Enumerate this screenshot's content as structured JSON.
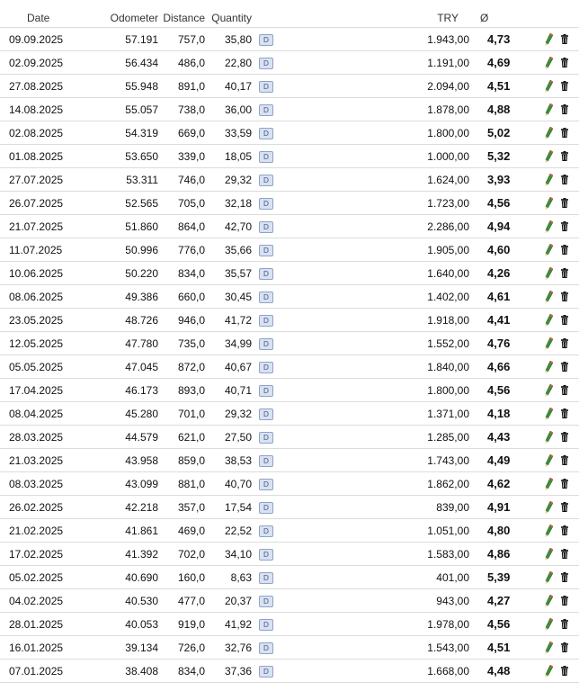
{
  "table": {
    "headers": {
      "date": "Date",
      "odometer": "Odometer",
      "distance": "Distance",
      "quantity": "Quantity",
      "cost": "TRY",
      "average": "Ø"
    },
    "rows": [
      {
        "date": "09.09.2025",
        "odometer": "57.191",
        "distance": "757,0",
        "quantity": "35,80",
        "badge": "D",
        "cost": "1.943,00",
        "average": "4,73"
      },
      {
        "date": "02.09.2025",
        "odometer": "56.434",
        "distance": "486,0",
        "quantity": "22,80",
        "badge": "D",
        "cost": "1.191,00",
        "average": "4,69"
      },
      {
        "date": "27.08.2025",
        "odometer": "55.948",
        "distance": "891,0",
        "quantity": "40,17",
        "badge": "D",
        "cost": "2.094,00",
        "average": "4,51"
      },
      {
        "date": "14.08.2025",
        "odometer": "55.057",
        "distance": "738,0",
        "quantity": "36,00",
        "badge": "D",
        "cost": "1.878,00",
        "average": "4,88"
      },
      {
        "date": "02.08.2025",
        "odometer": "54.319",
        "distance": "669,0",
        "quantity": "33,59",
        "badge": "D",
        "cost": "1.800,00",
        "average": "5,02"
      },
      {
        "date": "01.08.2025",
        "odometer": "53.650",
        "distance": "339,0",
        "quantity": "18,05",
        "badge": "D",
        "cost": "1.000,00",
        "average": "5,32"
      },
      {
        "date": "27.07.2025",
        "odometer": "53.311",
        "distance": "746,0",
        "quantity": "29,32",
        "badge": "D",
        "cost": "1.624,00",
        "average": "3,93"
      },
      {
        "date": "26.07.2025",
        "odometer": "52.565",
        "distance": "705,0",
        "quantity": "32,18",
        "badge": "D",
        "cost": "1.723,00",
        "average": "4,56"
      },
      {
        "date": "21.07.2025",
        "odometer": "51.860",
        "distance": "864,0",
        "quantity": "42,70",
        "badge": "D",
        "cost": "2.286,00",
        "average": "4,94"
      },
      {
        "date": "11.07.2025",
        "odometer": "50.996",
        "distance": "776,0",
        "quantity": "35,66",
        "badge": "D",
        "cost": "1.905,00",
        "average": "4,60"
      },
      {
        "date": "10.06.2025",
        "odometer": "50.220",
        "distance": "834,0",
        "quantity": "35,57",
        "badge": "D",
        "cost": "1.640,00",
        "average": "4,26"
      },
      {
        "date": "08.06.2025",
        "odometer": "49.386",
        "distance": "660,0",
        "quantity": "30,45",
        "badge": "D",
        "cost": "1.402,00",
        "average": "4,61"
      },
      {
        "date": "23.05.2025",
        "odometer": "48.726",
        "distance": "946,0",
        "quantity": "41,72",
        "badge": "D",
        "cost": "1.918,00",
        "average": "4,41"
      },
      {
        "date": "12.05.2025",
        "odometer": "47.780",
        "distance": "735,0",
        "quantity": "34,99",
        "badge": "D",
        "cost": "1.552,00",
        "average": "4,76"
      },
      {
        "date": "05.05.2025",
        "odometer": "47.045",
        "distance": "872,0",
        "quantity": "40,67",
        "badge": "D",
        "cost": "1.840,00",
        "average": "4,66"
      },
      {
        "date": "17.04.2025",
        "odometer": "46.173",
        "distance": "893,0",
        "quantity": "40,71",
        "badge": "D",
        "cost": "1.800,00",
        "average": "4,56"
      },
      {
        "date": "08.04.2025",
        "odometer": "45.280",
        "distance": "701,0",
        "quantity": "29,32",
        "badge": "D",
        "cost": "1.371,00",
        "average": "4,18"
      },
      {
        "date": "28.03.2025",
        "odometer": "44.579",
        "distance": "621,0",
        "quantity": "27,50",
        "badge": "D",
        "cost": "1.285,00",
        "average": "4,43"
      },
      {
        "date": "21.03.2025",
        "odometer": "43.958",
        "distance": "859,0",
        "quantity": "38,53",
        "badge": "D",
        "cost": "1.743,00",
        "average": "4,49"
      },
      {
        "date": "08.03.2025",
        "odometer": "43.099",
        "distance": "881,0",
        "quantity": "40,70",
        "badge": "D",
        "cost": "1.862,00",
        "average": "4,62"
      },
      {
        "date": "26.02.2025",
        "odometer": "42.218",
        "distance": "357,0",
        "quantity": "17,54",
        "badge": "D",
        "cost": "839,00",
        "average": "4,91"
      },
      {
        "date": "21.02.2025",
        "odometer": "41.861",
        "distance": "469,0",
        "quantity": "22,52",
        "badge": "D",
        "cost": "1.051,00",
        "average": "4,80"
      },
      {
        "date": "17.02.2025",
        "odometer": "41.392",
        "distance": "702,0",
        "quantity": "34,10",
        "badge": "D",
        "cost": "1.583,00",
        "average": "4,86"
      },
      {
        "date": "05.02.2025",
        "odometer": "40.690",
        "distance": "160,0",
        "quantity": "8,63",
        "badge": "D",
        "cost": "401,00",
        "average": "5,39"
      },
      {
        "date": "04.02.2025",
        "odometer": "40.530",
        "distance": "477,0",
        "quantity": "20,37",
        "badge": "D",
        "cost": "943,00",
        "average": "4,27"
      },
      {
        "date": "28.01.2025",
        "odometer": "40.053",
        "distance": "919,0",
        "quantity": "41,92",
        "badge": "D",
        "cost": "1.978,00",
        "average": "4,56"
      },
      {
        "date": "16.01.2025",
        "odometer": "39.134",
        "distance": "726,0",
        "quantity": "32,76",
        "badge": "D",
        "cost": "1.543,00",
        "average": "4,51"
      },
      {
        "date": "07.01.2025",
        "odometer": "38.408",
        "distance": "834,0",
        "quantity": "37,36",
        "badge": "D",
        "cost": "1.668,00",
        "average": "4,48"
      }
    ]
  },
  "icons": {
    "edit": "pencil-icon",
    "delete": "trash-icon"
  },
  "colors": {
    "badge_fill": "#d8e2f2",
    "badge_border": "#8fa3c8",
    "row_divider": "#dcdcdc",
    "pencil_body": "#3f8f3a",
    "pencil_tip": "#e0553c",
    "trash": "#111111"
  }
}
